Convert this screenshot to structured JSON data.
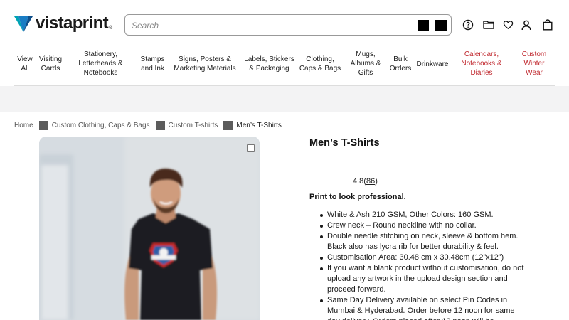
{
  "header": {
    "logo_text": "vistaprint",
    "logo_reg": "®",
    "search_placeholder": "Search",
    "icons": [
      "help-icon",
      "folder-icon",
      "heart-icon",
      "account-icon",
      "bag-icon"
    ]
  },
  "nav": [
    {
      "label": "View\nAll"
    },
    {
      "label": "Visiting\nCards"
    },
    {
      "label": "Stationery,\nLetterheads &\nNotebooks"
    },
    {
      "label": "Stamps\nand Ink"
    },
    {
      "label": "Signs, Posters &\nMarketing Materials"
    },
    {
      "label": "Labels, Stickers\n& Packaging"
    },
    {
      "label": "Clothing,\nCaps & Bags"
    },
    {
      "label": "Mugs,\nAlbums &\nGifts"
    },
    {
      "label": "Bulk\nOrders"
    },
    {
      "label": "Drinkware"
    },
    {
      "label": "Calendars,\nNotebooks &\nDiaries"
    },
    {
      "label": "Custom\nWinter\nWear"
    }
  ],
  "breadcrumb": {
    "home": "Home",
    "level1": "Custom Clothing, Caps & Bags",
    "level2": "Custom T-shirts",
    "current": "Men’s T-Shirts"
  },
  "product": {
    "title": "Men’s T-Shirts",
    "rating_value": "4.8",
    "rating_open": "(",
    "rating_count": "86",
    "rating_close": ")",
    "tagline": "Print to look professional.",
    "bullet1": "White & Ash 210 GSM, Other Colors: 160 GSM.",
    "bullet2": "Crew neck – Round neckline with no collar.",
    "bullet3": "Double needle stitching on neck, sleeve & bottom hem. Black also has lycra rib for better durability & feel.",
    "bullet4": "Customisation Area: 30.48 cm x 30.48cm (12”x12”)",
    "bullet5": "If you want a blank product without customisation, do not upload any artwork in the upload design section and proceed forward.",
    "bullet6_a": "Same Day Delivery available on select Pin Codes in ",
    "bullet6_city1": "Mumbai",
    "bullet6_amp": " & ",
    "bullet6_city2": "Hyderabad",
    "bullet6_b": ". Order before 12 noon for same day delivery. Orders placed after 12 noon will be"
  },
  "colors": {
    "accent_red": "#c0282e",
    "logo_blue": "#1a7dc4",
    "logo_teal": "#00a3b4",
    "banner_bg": "#f3f3f4"
  }
}
